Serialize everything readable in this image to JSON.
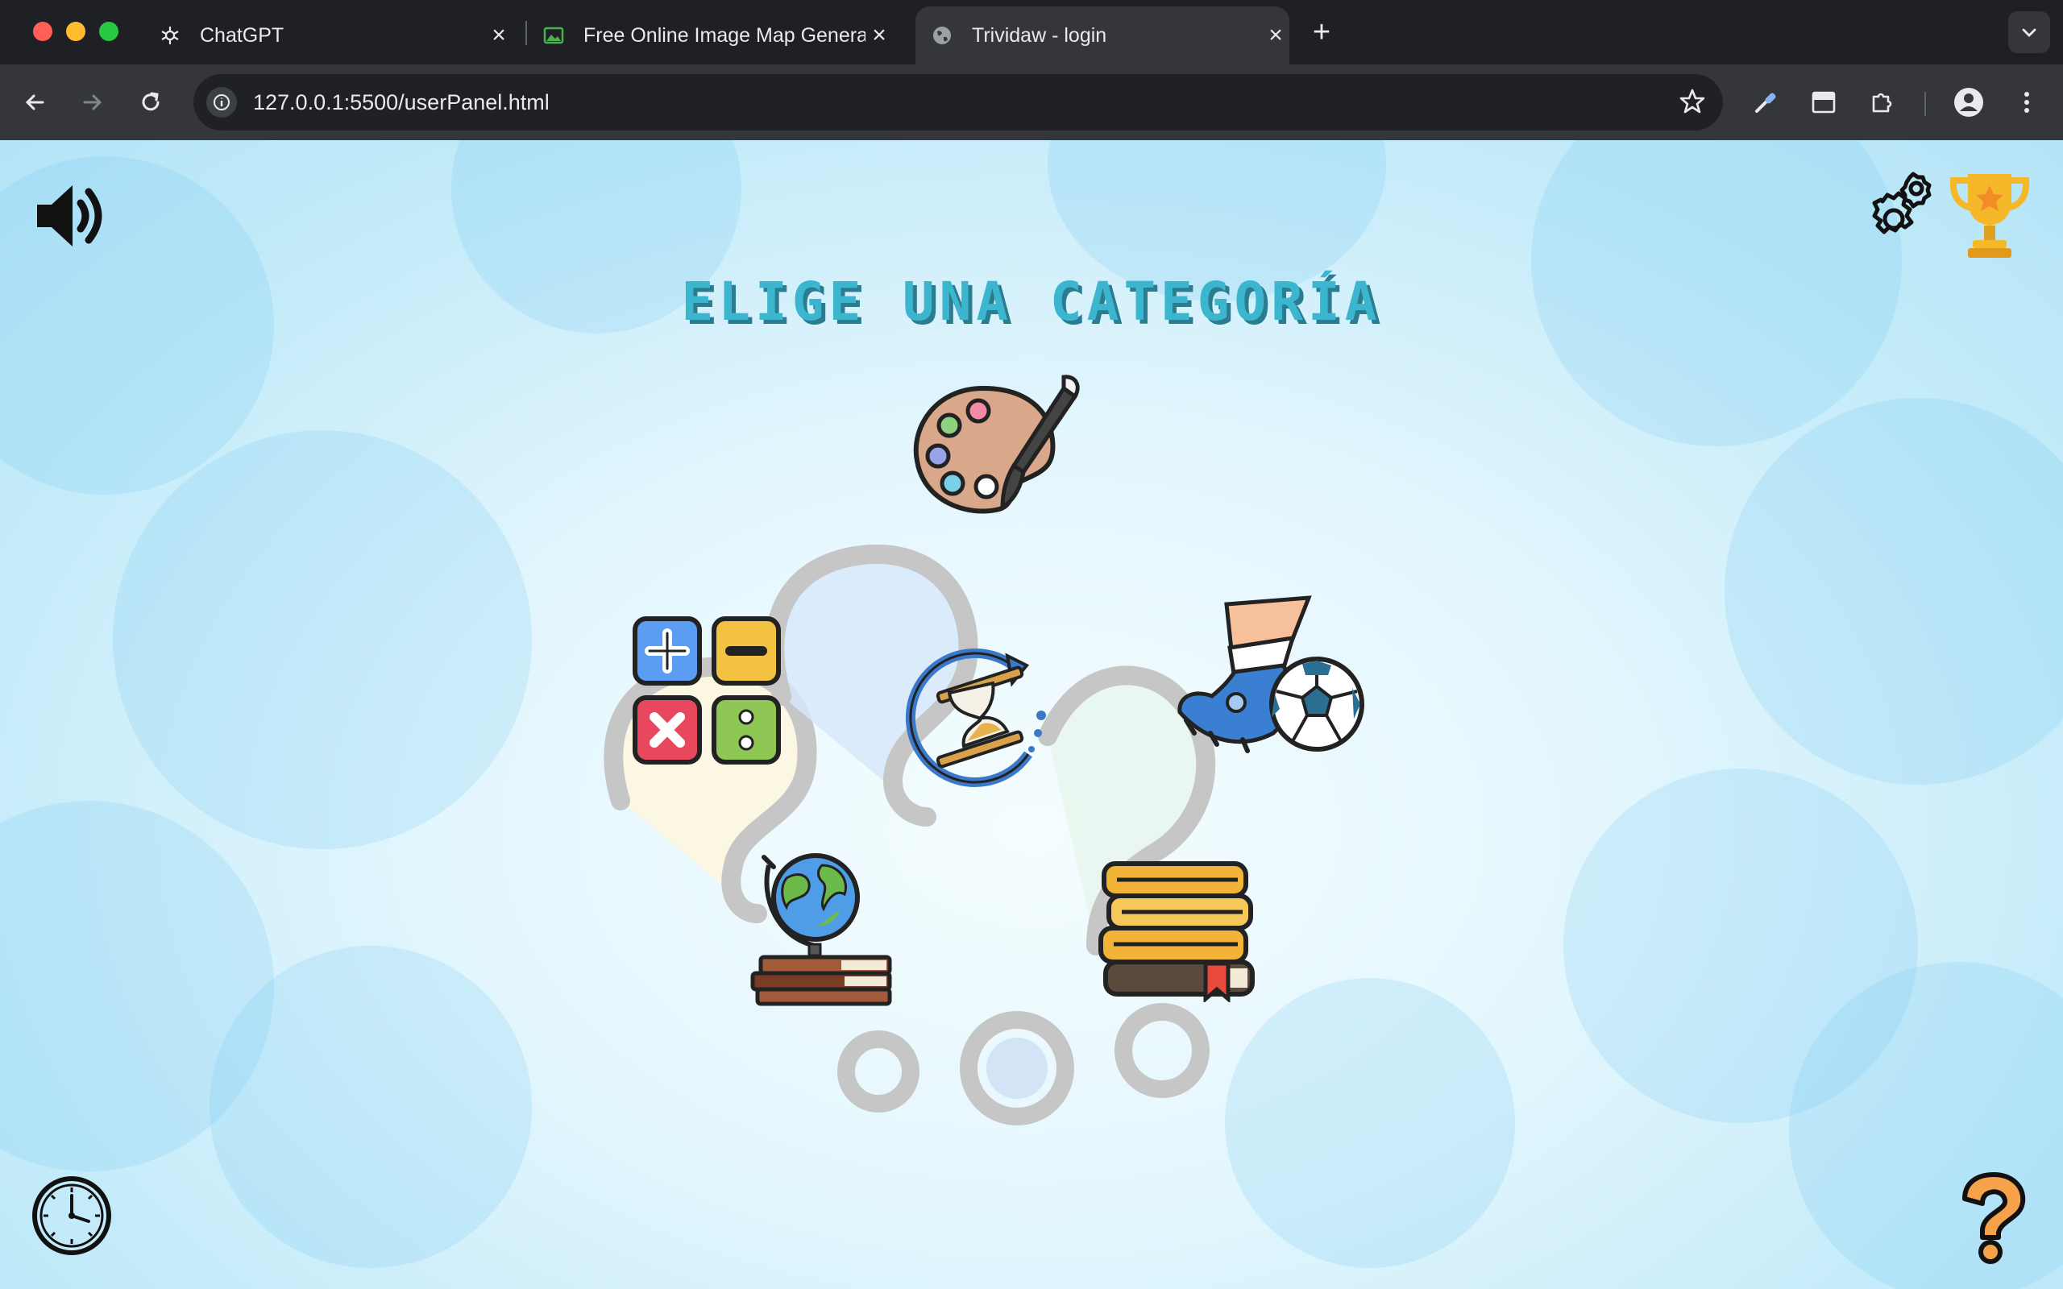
{
  "browser": {
    "tabs": [
      {
        "title": "ChatGPT",
        "favicon": "openai-icon",
        "active": false
      },
      {
        "title": "Free Online Image Map Generator",
        "favicon": "image-icon",
        "active": false
      },
      {
        "title": "Trividaw - login",
        "favicon": "globe-icon",
        "active": true
      }
    ],
    "url": "127.0.0.1:5500/userPanel.html",
    "colors": {
      "tabbar": "#1f2023",
      "toolbar": "#35363a",
      "omnibox": "#202124"
    }
  },
  "page": {
    "heading": "ELIGE UNA CATEGORÍA",
    "colors": {
      "heading": "#3cb6cf",
      "heading_shadow": "#2b7c90",
      "background": "#d6f1fb"
    },
    "icons": {
      "sound": "speaker-icon",
      "settings": "gears-icon",
      "ranking": "trophy-icon",
      "history_log": "clock-icon",
      "help": "question-mark-icon"
    },
    "categories": [
      {
        "id": "art",
        "icon": "palette-icon"
      },
      {
        "id": "math",
        "icon": "math-operators-icon"
      },
      {
        "id": "history",
        "icon": "hourglass-icon"
      },
      {
        "id": "sports",
        "icon": "soccer-kick-icon"
      },
      {
        "id": "geography",
        "icon": "globe-on-books-icon"
      },
      {
        "id": "literature",
        "icon": "book-stack-icon"
      }
    ]
  }
}
